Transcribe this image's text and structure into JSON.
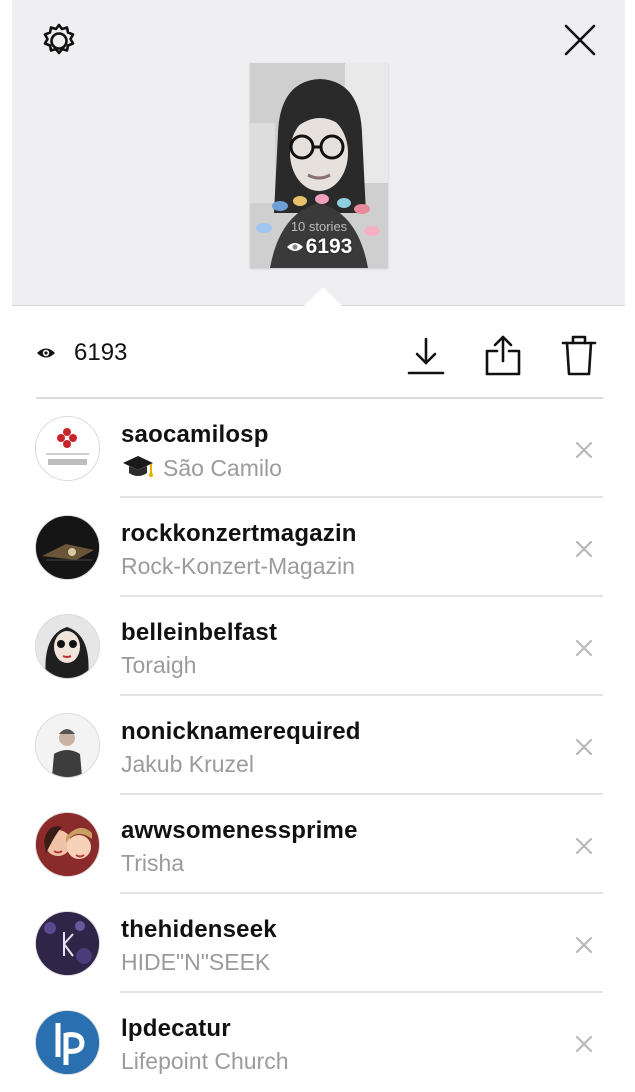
{
  "header": {
    "settings_icon": "gear-icon",
    "close_icon": "close-icon",
    "thumbnail": {
      "caption": "10 stories",
      "views": "6193"
    }
  },
  "stats": {
    "eye_icon": "eye-icon",
    "view_count": "6193",
    "actions": [
      "download-icon",
      "share-icon",
      "trash-icon"
    ]
  },
  "viewers": [
    {
      "username": "saocamilosp",
      "fullname": "São Camilo",
      "has_emoji": true,
      "avatar_color": "#ffffff"
    },
    {
      "username": "rockkonzertmagazin",
      "fullname": "Rock-Konzert-Magazin",
      "has_emoji": false,
      "avatar_color": "#1c1c1c"
    },
    {
      "username": "belleinbelfast",
      "fullname": "Toraigh",
      "has_emoji": false,
      "avatar_color": "#e9e9e9"
    },
    {
      "username": "nonicknamerequired",
      "fullname": "Jakub Kruzel",
      "has_emoji": false,
      "avatar_color": "#f4f4f4"
    },
    {
      "username": "awwsomenessprime",
      "fullname": "Trisha",
      "has_emoji": false,
      "avatar_color": "#c75a3f"
    },
    {
      "username": "thehidenseek",
      "fullname": "HIDE\"N\"SEEK",
      "has_emoji": false,
      "avatar_color": "#3a2f59"
    },
    {
      "username": "lpdecatur",
      "fullname": "Lifepoint Church",
      "has_emoji": false,
      "avatar_color": "#2a6fb0"
    }
  ],
  "colors": {
    "top_background": "#efeff1",
    "secondary_text": "#9b9b9b",
    "primary_text": "#111111",
    "remove_icon": "#b9b9bb"
  }
}
